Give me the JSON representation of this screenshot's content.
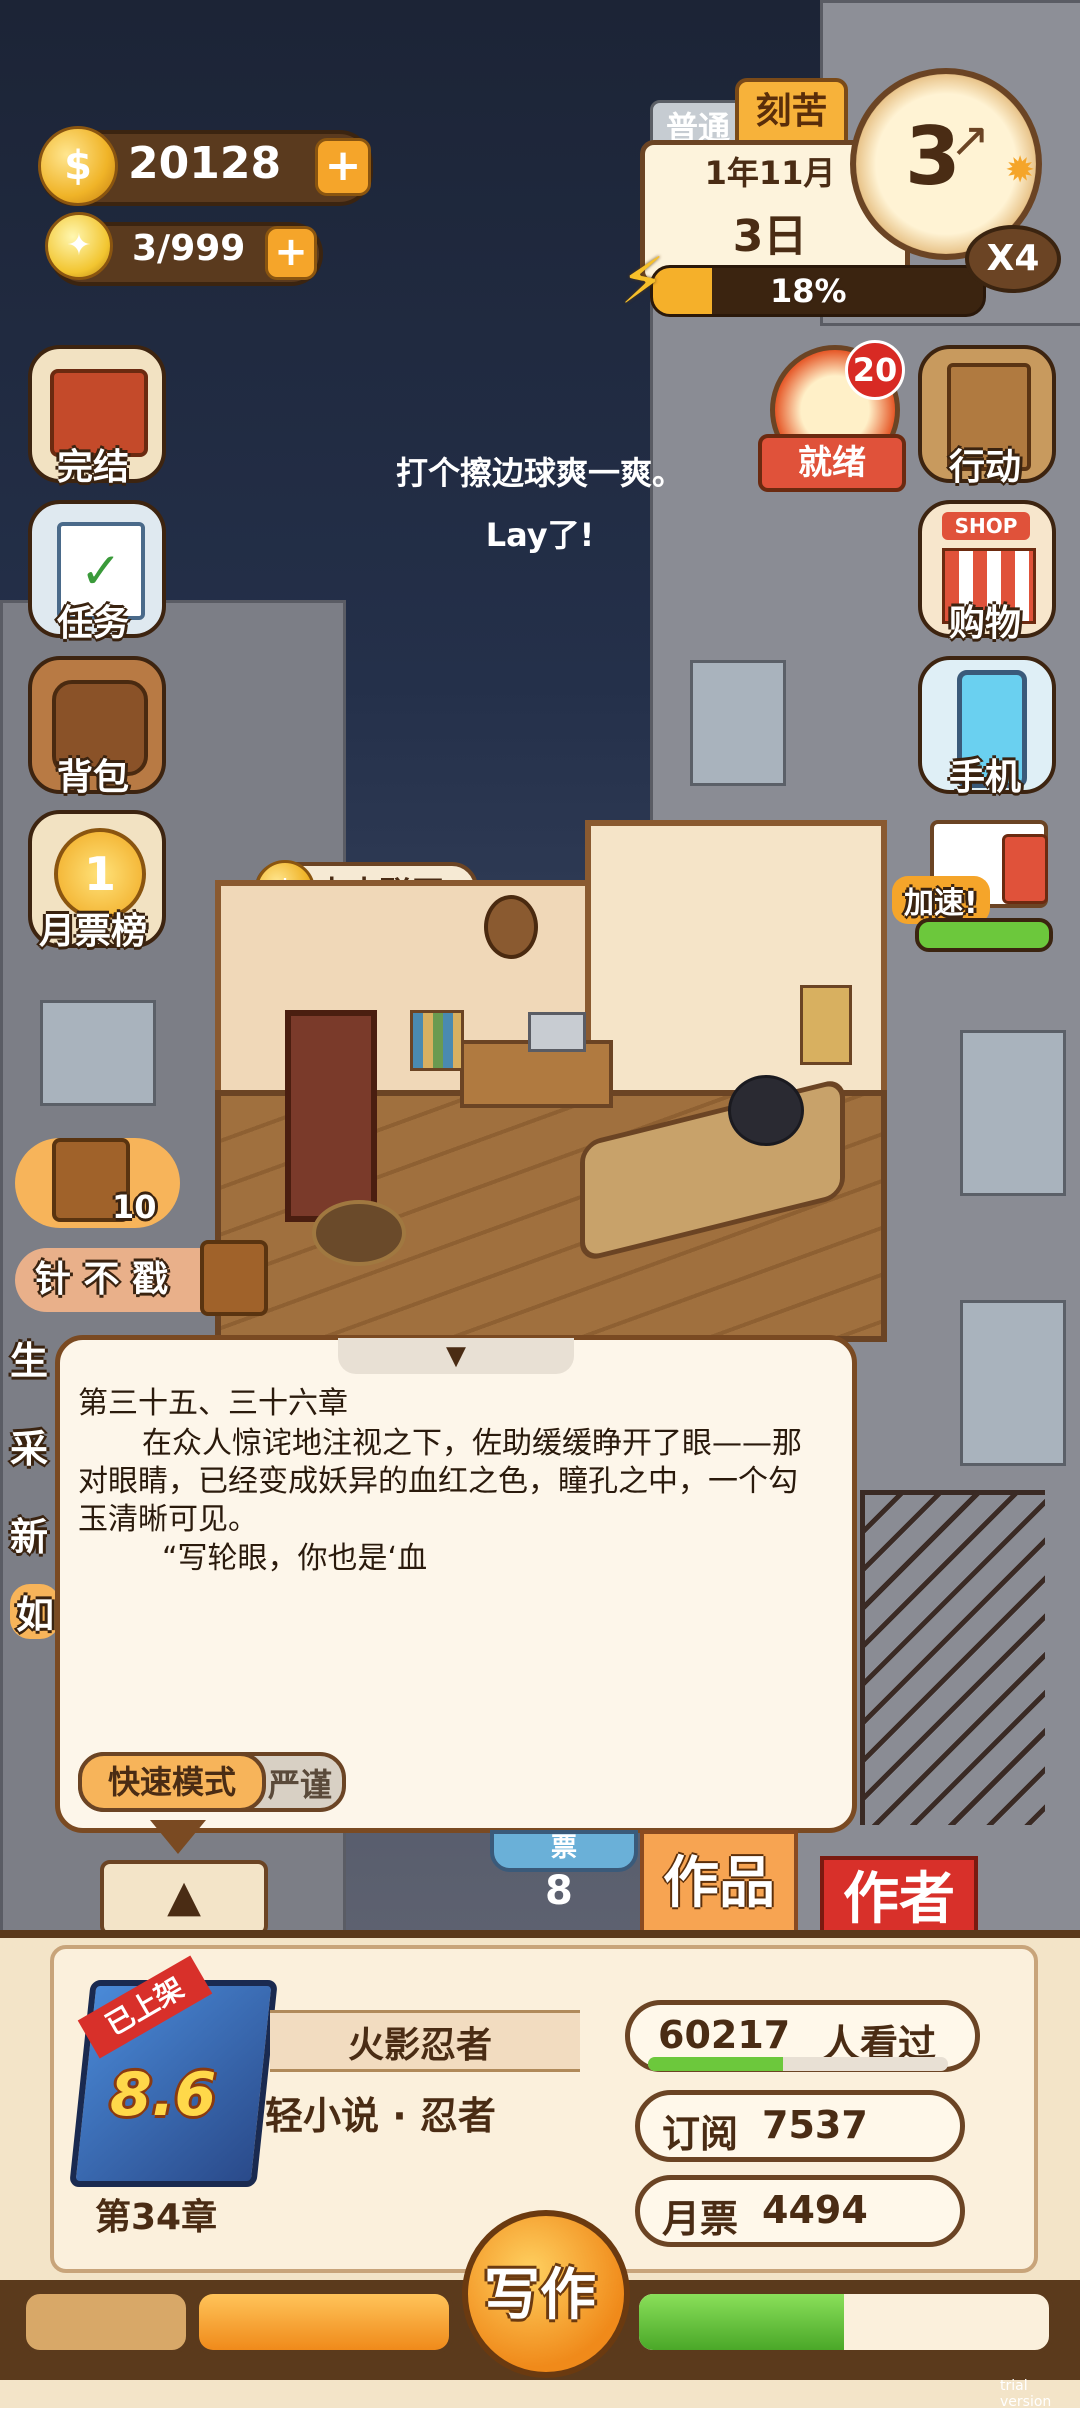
{
  "currency": {
    "coins": "20128",
    "energy": "3/999",
    "add_label": "+"
  },
  "time": {
    "mode_normal": "普通",
    "mode_hard": "刻苦",
    "year_month": "1年11月",
    "day": "3日",
    "progress": "18%",
    "progress_value": 0.18,
    "clock_number": "3",
    "speed": "X4"
  },
  "left_menu": [
    {
      "label": "完结"
    },
    {
      "label": "任务"
    },
    {
      "label": "背包"
    },
    {
      "label": "月票榜"
    }
  ],
  "right_menu": {
    "ready_label": "就绪",
    "ready_badge": "20",
    "action_label": "行动",
    "shop_label": "购物",
    "shop_sign": "SHOP",
    "phone_label": "手机",
    "speedup_label": "加速!"
  },
  "dialog": {
    "line1": "打个擦边球爽一爽。",
    "line2": "Lay了!"
  },
  "network_label": "点击联网",
  "chest": {
    "count": "10"
  },
  "chips": {
    "chip1": "针 不 戳",
    "side_chars": [
      "生",
      "采",
      "新",
      "如"
    ]
  },
  "book_popup": {
    "heading": "第三十五、三十六章",
    "paragraph1": "在众人惊诧地注视之下，佐助缓缓睁开了眼——那对眼睛，已经变成妖异的血红之色，瞳孔之中，一个勾玉清晰可见。",
    "paragraph2": "“写轮眼，你也是‘血",
    "mode_fast": "快速模式",
    "mode_strict": "严谨"
  },
  "tabs": {
    "count": "8",
    "works": "作品",
    "author": "作者",
    "partial_tab": "票"
  },
  "book": {
    "badge": "已上架",
    "rating": "8.6",
    "title": "火影忍者",
    "genre": "轻小说 · 忍者",
    "chapter": "第34章"
  },
  "stats": {
    "viewers": "60217",
    "viewers_label": "人看过",
    "viewers_progress": 0.45,
    "subs_label": "订阅",
    "subs_value": "7537",
    "tickets_label": "月票",
    "tickets_value": "4494"
  },
  "write_button": "写作",
  "bars": {
    "left_fill": 1.0,
    "right_fill": 0.5
  },
  "watermark": "trial version",
  "colors": {
    "accent_orange": "#f5a52a",
    "brown": "#6b4424",
    "red_badge": "#d82a24",
    "green": "#6cc83c"
  }
}
